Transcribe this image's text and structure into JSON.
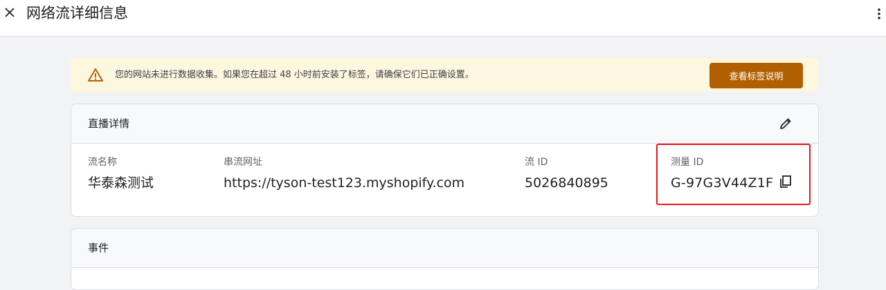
{
  "header": {
    "title": "网络流详细信息",
    "close_icon": "close-icon",
    "more_icon": "more-vert-icon"
  },
  "banner": {
    "icon": "warning-icon",
    "message": "您的网站未进行数据收集。如果您在超过 48 小时前安装了标签，请确保它们已正确设置。",
    "button_label": "查看标签说明",
    "accent_color": "#b06000"
  },
  "details_card": {
    "title": "直播详情",
    "edit_icon": "edit-icon",
    "fields": [
      {
        "label": "流名称",
        "value": "华泰森测试"
      },
      {
        "label": "串流网址",
        "value": "https://tyson-test123.myshopify.com"
      },
      {
        "label": "流 ID",
        "value": "5026840895"
      },
      {
        "label": "测量 ID",
        "value": "G-97G3V44Z1F"
      }
    ],
    "copy_icon": "copy-icon",
    "highlight_color": "#e8161e"
  },
  "events_card": {
    "title": "事件"
  }
}
